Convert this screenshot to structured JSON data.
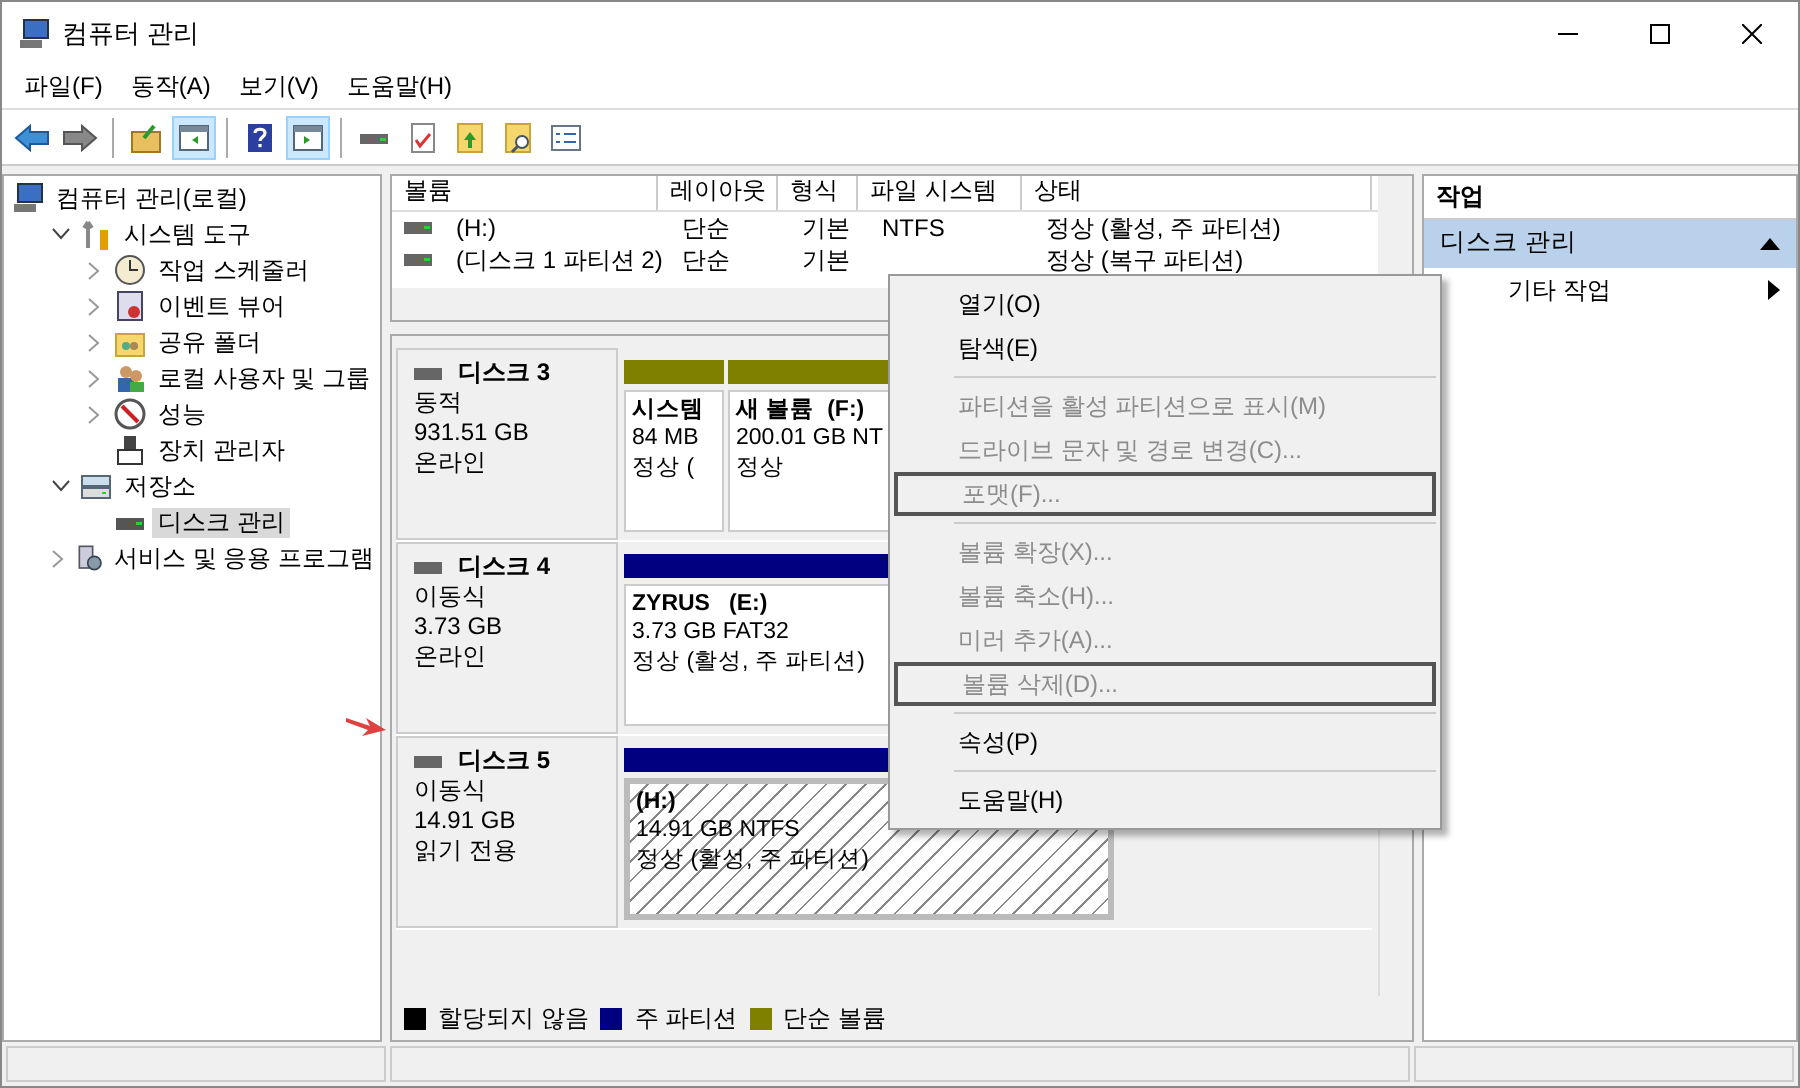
{
  "window": {
    "title": "컴퓨터 관리"
  },
  "menu": [
    "파일(F)",
    "동작(A)",
    "보기(V)",
    "도움말(H)"
  ],
  "toolbar": [
    {
      "kind": "back",
      "pressed": false
    },
    {
      "kind": "forward",
      "pressed": false
    },
    {
      "kind": "sep"
    },
    {
      "kind": "up",
      "pressed": false
    },
    {
      "kind": "tree",
      "pressed": true
    },
    {
      "kind": "sep"
    },
    {
      "kind": "help",
      "pressed": false
    },
    {
      "kind": "pane",
      "pressed": true
    },
    {
      "kind": "sep"
    },
    {
      "kind": "disk",
      "pressed": false
    },
    {
      "kind": "check",
      "pressed": false
    },
    {
      "kind": "folderup",
      "pressed": false
    },
    {
      "kind": "foldersearch",
      "pressed": false
    },
    {
      "kind": "list",
      "pressed": false
    }
  ],
  "tree": [
    {
      "label": "컴퓨터 관리(로컬)",
      "selected": false,
      "children": [
        {
          "label": "시스템 도구",
          "expanded": true,
          "selected": false,
          "children": [
            {
              "label": "작업 스케줄러",
              "expanded": false,
              "selected": false
            },
            {
              "label": "이벤트 뷰어",
              "expanded": false,
              "selected": false
            },
            {
              "label": "공유 폴더",
              "expanded": false,
              "selected": false
            },
            {
              "label": "로컬 사용자 및 그룹",
              "expanded": false,
              "selected": false
            },
            {
              "label": "성능",
              "expanded": false,
              "selected": false
            },
            {
              "label": "장치 관리자",
              "selected": false
            }
          ]
        },
        {
          "label": "저장소",
          "expanded": true,
          "selected": false,
          "children": [
            {
              "label": "디스크 관리",
              "selected": true
            }
          ]
        },
        {
          "label": "서비스 및 응용 프로그램",
          "expanded": false,
          "selected": false
        }
      ]
    }
  ],
  "volumes": {
    "columns": [
      "볼륨",
      "레이아웃",
      "형식",
      "파일 시스템",
      "상태"
    ],
    "rows": [
      [
        "(H:)",
        "단순",
        "기본",
        "NTFS",
        "정상 (활성, 주 파티션)"
      ],
      [
        "(디스크 1 파티션 2)",
        "단순",
        "기본",
        "",
        "정상 (복구 파티션)"
      ]
    ]
  },
  "disks": [
    {
      "name": "디스크 3",
      "type": "동적",
      "size": "931.51 GB",
      "status": "온라인",
      "partitions": [
        {
          "kind": "simple",
          "name": "시스템",
          "size": "84 MB",
          "status": "정상 (",
          "selected": false
        },
        {
          "kind": "simple",
          "name": "새 볼륨  (F:)",
          "size": "200.01 GB NT",
          "status": "정상",
          "selected": false
        }
      ]
    },
    {
      "name": "디스크 4",
      "type": "이동식",
      "size": "3.73 GB",
      "status": "온라인",
      "partitions": [
        {
          "kind": "primary",
          "name": "ZYRUS   (E:)",
          "size": "3.73 GB FAT32",
          "status": "정상 (활성, 주 파티션)",
          "selected": false
        }
      ]
    },
    {
      "name": "디스크 5",
      "type": "이동식",
      "size": "14.91 GB",
      "status": "읽기 전용",
      "partitions": [
        {
          "kind": "primary",
          "name": "(H:)",
          "size": "14.91 GB NTFS",
          "status": "정상 (활성, 주 파티션)",
          "selected": true
        }
      ]
    }
  ],
  "legend": [
    {
      "label": "할당되지 않음",
      "color": "#000000"
    },
    {
      "label": "주 파티션",
      "color": "#000080"
    },
    {
      "label": "단순 볼륨",
      "color": "#808000"
    }
  ],
  "actions": {
    "title": "작업",
    "section": "디스크 관리",
    "items": [
      "기타 작업"
    ]
  },
  "context_menu": [
    {
      "kind": "item",
      "label": "열기(O)",
      "disabled": false,
      "outlined": false
    },
    {
      "kind": "item",
      "label": "탐색(E)",
      "disabled": false,
      "outlined": false
    },
    {
      "kind": "separator"
    },
    {
      "kind": "item",
      "label": "파티션을 활성 파티션으로 표시(M)",
      "disabled": true,
      "outlined": false
    },
    {
      "kind": "item",
      "label": "드라이브 문자 및 경로 변경(C)...",
      "disabled": true,
      "outlined": false
    },
    {
      "kind": "item",
      "label": "포맷(F)...",
      "disabled": true,
      "outlined": true
    },
    {
      "kind": "separator"
    },
    {
      "kind": "item",
      "label": "볼륨 확장(X)...",
      "disabled": true,
      "outlined": false
    },
    {
      "kind": "item",
      "label": "볼륨 축소(H)...",
      "disabled": true,
      "outlined": false
    },
    {
      "kind": "item",
      "label": "미러 추가(A)...",
      "disabled": true,
      "outlined": false
    },
    {
      "kind": "item",
      "label": "볼륨 삭제(D)...",
      "disabled": true,
      "outlined": true
    },
    {
      "kind": "separator"
    },
    {
      "kind": "item",
      "label": "속성(P)",
      "disabled": false,
      "outlined": false
    },
    {
      "kind": "separator"
    },
    {
      "kind": "item",
      "label": "도움말(H)",
      "disabled": false,
      "outlined": false
    }
  ]
}
